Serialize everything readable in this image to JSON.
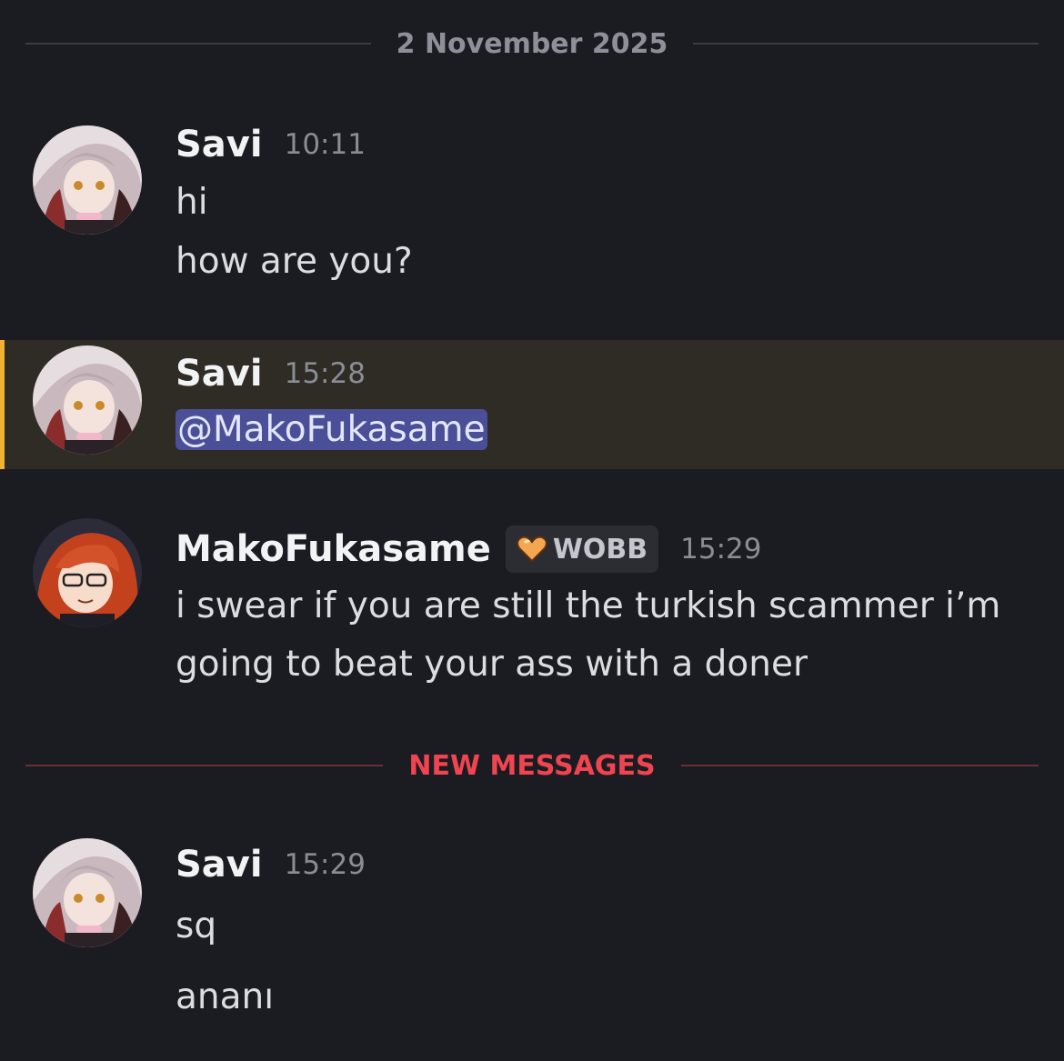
{
  "date_divider": "2 November 2025",
  "new_divider": "NEW MESSAGES",
  "colors": {
    "background": "#1b1c21",
    "highlight_background": "#2f2b25",
    "highlight_border": "#f0b232",
    "mention_background": "#4b4f98",
    "new_messages": "#f04451"
  },
  "messages": [
    {
      "author": "Savi",
      "time": "10:11",
      "avatar": "savi-avatar",
      "lines": [
        "hi",
        "how are you?"
      ]
    },
    {
      "author": "Savi",
      "time": "15:28",
      "avatar": "savi-avatar",
      "mention": "@MakoFukasame",
      "highlighted": true
    },
    {
      "author": "MakoFukasame",
      "time": "15:29",
      "avatar": "mako-avatar",
      "badge": {
        "icon": "heart-icon",
        "label": "WOBB"
      },
      "lines": [
        "i swear if you are still the turkish scammer i’m",
        "going to beat your ass with a doner"
      ]
    },
    {
      "author": "Savi",
      "time": "15:29",
      "avatar": "savi-avatar",
      "lines": [
        "sq",
        "ananı"
      ]
    }
  ]
}
